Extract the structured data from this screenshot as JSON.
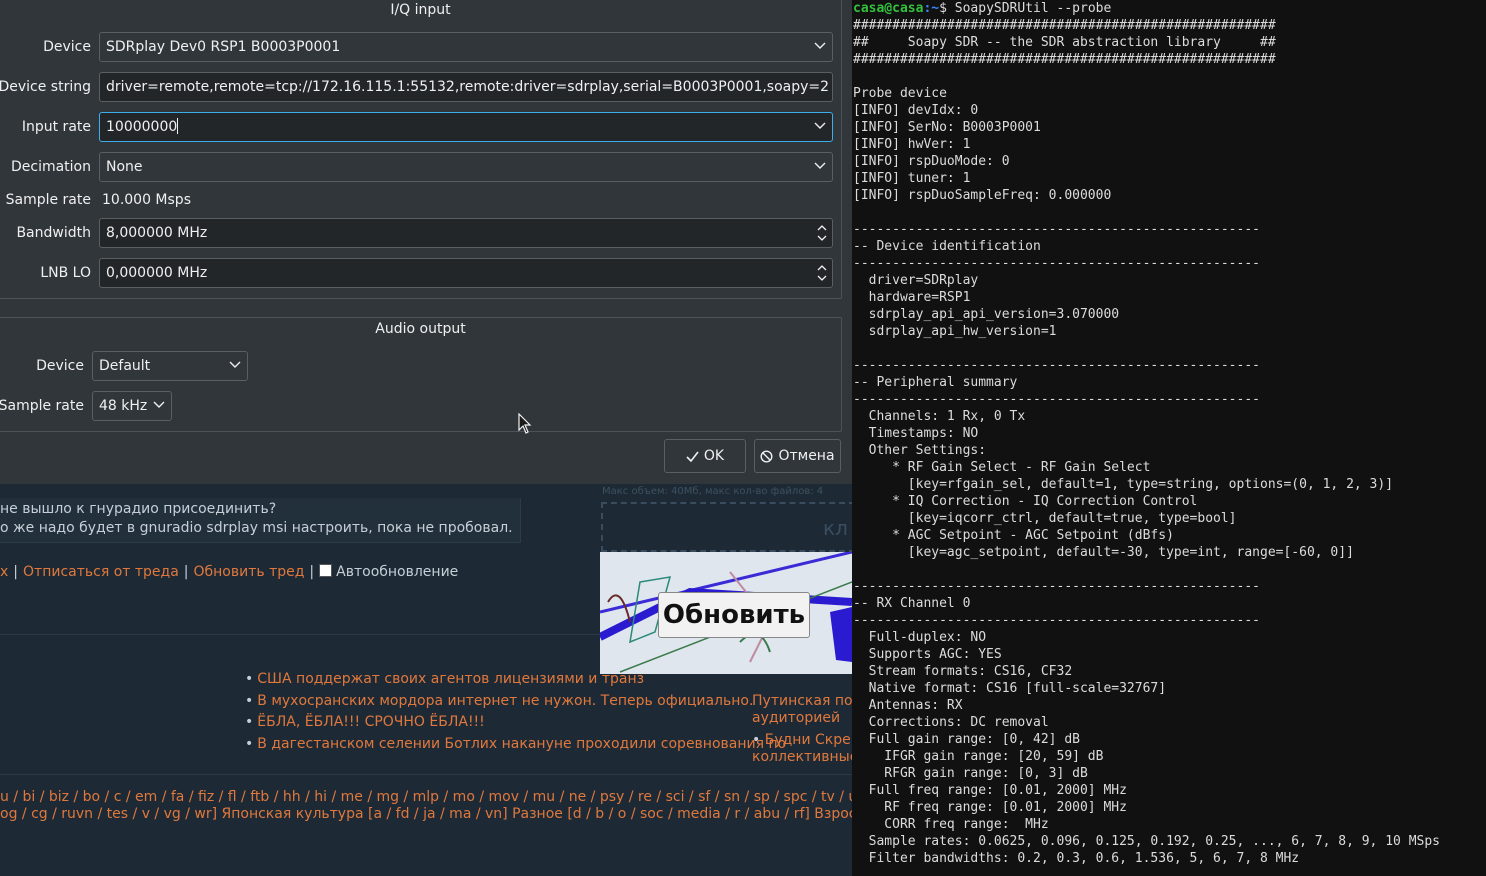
{
  "dialog": {
    "iq_group": {
      "title": "I/Q input",
      "device_label": "Device",
      "device_value": "SDRplay Dev0 RSP1 B0003P0001",
      "device_string_label": "Device string",
      "device_string_value": "driver=remote,remote=tcp://172.16.115.1:55132,remote:driver=sdrplay,serial=B0003P0001,soapy=2",
      "input_rate_label": "Input rate",
      "input_rate_value": "10000000",
      "decimation_label": "Decimation",
      "decimation_value": "None",
      "sample_rate_label": "Sample rate",
      "sample_rate_value": "10.000 Msps",
      "bandwidth_label": "Bandwidth",
      "bandwidth_value": "8,000000 MHz",
      "lnb_label": "LNB LO",
      "lnb_value": "0,000000 MHz"
    },
    "audio_group": {
      "title": "Audio output",
      "device_label": "Device",
      "device_value": "Default",
      "sample_rate_label": "Sample rate",
      "sample_rate_value": "48 kHz"
    },
    "ok_label": "OK",
    "cancel_label": "Отмена"
  },
  "web": {
    "post_line1": "не вышло к гнурадио присоединить?",
    "post_line2": "о же надо будет в gnuradio sdrplay msi настроить, пока не пробовал.",
    "link_x": "x",
    "link_unsubscribe": "Отписаться от треда",
    "link_refresh_thread": "Обновить тред",
    "autoupdate_label": "Автообновление",
    "upload_limit": "Макс объем: 40Mб, макс кол-во файлов: 4",
    "drop_text": "кл",
    "captcha_refresh": "Обновить",
    "news": [
      "США поддержат своих агентов лицензиями и транз",
      "В мухосранских мордора интернет не нужон. Теперь официально.",
      "ЁБЛА, ЁБЛА!!! СРОЧНО ЁБЛА!!!",
      "В дагестанском селении Ботлих накануне проходили соревнования по"
    ],
    "news_right": [
      "Путинская по",
      "аудиторией",
      "Будни Скрепо",
      "коллективные"
    ],
    "boards_line1": "u / bi / biz / bo / c / em / fa / fiz / fl / ftb / hh / hi / me / mg / mlp / mo / mov / mu / ne / psy / re / sci / sf / sn / sp / spc / tv / un / w / wh / w",
    "boards_line2": "og / cg / ruvn / tes / v / vg / wr] Японская культура [a / fd / ja / ma / vn] Разное [d / b / o / soc / media / r / abu / rf] Взрослым [fg / fur /"
  },
  "terminal": {
    "user_host": "casa@casa",
    "cwd": ":~",
    "command": "$ SoapySDRUtil --probe",
    "output": "######################################################\n##     Soapy SDR -- the SDR abstraction library     ##\n######################################################\n\nProbe device\n[INFO] devIdx: 0\n[INFO] SerNo: B0003P0001\n[INFO] hwVer: 1\n[INFO] rspDuoMode: 0\n[INFO] tuner: 1\n[INFO] rspDuoSampleFreq: 0.000000\n\n----------------------------------------------------\n-- Device identification\n----------------------------------------------------\n  driver=SDRplay\n  hardware=RSP1\n  sdrplay_api_api_version=3.070000\n  sdrplay_api_hw_version=1\n\n----------------------------------------------------\n-- Peripheral summary\n----------------------------------------------------\n  Channels: 1 Rx, 0 Tx\n  Timestamps: NO\n  Other Settings:\n     * RF Gain Select - RF Gain Select\n       [key=rfgain_sel, default=1, type=string, options=(0, 1, 2, 3)]\n     * IQ Correction - IQ Correction Control\n       [key=iqcorr_ctrl, default=true, type=bool]\n     * AGC Setpoint - AGC Setpoint (dBfs)\n       [key=agc_setpoint, default=-30, type=int, range=[-60, 0]]\n\n----------------------------------------------------\n-- RX Channel 0\n----------------------------------------------------\n  Full-duplex: NO\n  Supports AGC: YES\n  Stream formats: CS16, CF32\n  Native format: CS16 [full-scale=32767]\n  Antennas: RX\n  Corrections: DC removal\n  Full gain range: [0, 42] dB\n    IFGR gain range: [20, 59] dB\n    RFGR gain range: [0, 3] dB\n  Full freq range: [0.01, 2000] MHz\n    RF freq range: [0.01, 2000] MHz\n    CORR freq range:  MHz\n  Sample rates: 0.0625, 0.096, 0.125, 0.192, 0.25, ..., 6, 7, 8, 9, 10 MSps\n  Filter bandwidths: 0.2, 0.3, 0.6, 1.536, 5, 6, 7, 8 MHz"
  },
  "colors": {
    "dialog_bg": "#31363b",
    "field_bg": "#232629",
    "focus_border": "#3daee9",
    "web_bg": "#1d2a35",
    "link_orange": "#e0783d",
    "term_bg": "#111111",
    "prompt_green": "#33c13d",
    "prompt_blue": "#3b86ff"
  }
}
